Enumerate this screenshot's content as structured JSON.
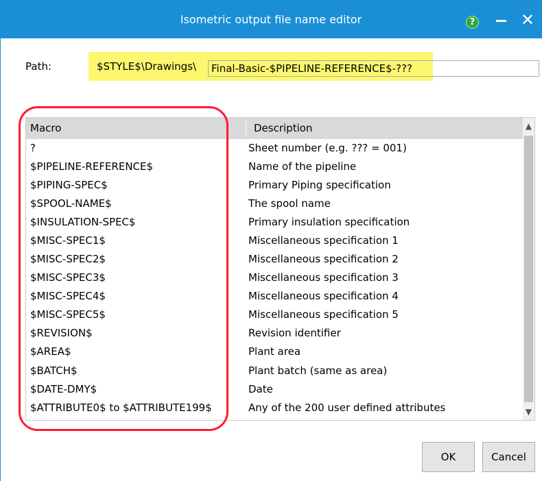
{
  "window": {
    "title": "Isometric output file name editor",
    "help_glyph": "?",
    "close_glyph": "✕"
  },
  "path": {
    "label": "Path:",
    "prefix": "$STYLE$\\Drawings\\",
    "value": "Final-Basic-$PIPELINE-REFERENCE$-???"
  },
  "table": {
    "headers": {
      "macro": "Macro",
      "description": "Description"
    },
    "rows": [
      {
        "macro": "?",
        "description": "Sheet number (e.g. ??? = 001)"
      },
      {
        "macro": "$PIPELINE-REFERENCE$",
        "description": "Name of the pipeline"
      },
      {
        "macro": "$PIPING-SPEC$",
        "description": "Primary Piping specification"
      },
      {
        "macro": "$SPOOL-NAME$",
        "description": "The spool name"
      },
      {
        "macro": "$INSULATION-SPEC$",
        "description": "Primary insulation specification"
      },
      {
        "macro": "$MISC-SPEC1$",
        "description": "Miscellaneous specification 1"
      },
      {
        "macro": "$MISC-SPEC2$",
        "description": "Miscellaneous specification 2"
      },
      {
        "macro": "$MISC-SPEC3$",
        "description": "Miscellaneous specification 3"
      },
      {
        "macro": "$MISC-SPEC4$",
        "description": "Miscellaneous specification 4"
      },
      {
        "macro": "$MISC-SPEC5$",
        "description": "Miscellaneous specification 5"
      },
      {
        "macro": "$REVISION$",
        "description": "Revision identifier"
      },
      {
        "macro": "$AREA$",
        "description": "Plant area"
      },
      {
        "macro": "$BATCH$",
        "description": "Plant batch (same as area)"
      },
      {
        "macro": "$DATE-DMY$",
        "description": "Date"
      },
      {
        "macro": "$ATTRIBUTE0$ to $ATTRIBUTE199$",
        "description": "Any of the 200 user defined attributes"
      }
    ]
  },
  "buttons": {
    "ok": "OK",
    "cancel": "Cancel"
  },
  "colors": {
    "titlebar": "#1b8fd6",
    "highlight": "#fdf76f",
    "annotation": "#ff1b30",
    "header": "#d9d9d9"
  },
  "icons": {
    "help": "question-circle-icon",
    "minimize": "minimize-icon",
    "close": "close-icon"
  }
}
